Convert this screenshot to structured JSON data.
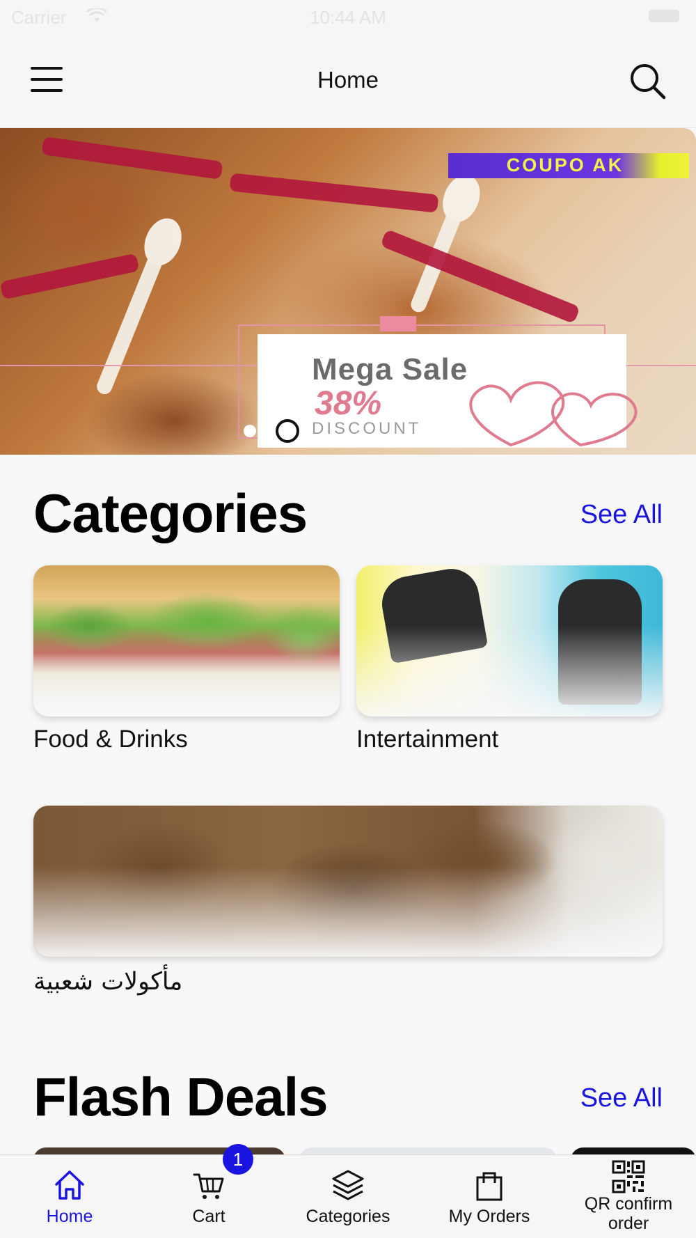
{
  "status_bar": {
    "carrier": "Carrier",
    "time": "10:44 AM"
  },
  "nav": {
    "title": "Home",
    "menu_icon": "hamburger-menu-icon",
    "search_icon": "search-icon"
  },
  "banner": {
    "logo_text": "COUPO AK",
    "headline": "Mega Sale",
    "discount_percent": "38%",
    "discount_label": "DISCOUNT",
    "slide_count": 2,
    "active_slide": 2
  },
  "categories": {
    "title": "Categories",
    "see_all": "See All",
    "items": [
      {
        "label": "Food & Drinks"
      },
      {
        "label": "Intertainment"
      },
      {
        "label": "مأكولات شعبية"
      }
    ]
  },
  "flash_deals": {
    "title": "Flash Deals",
    "see_all": "See All"
  },
  "tab_bar": {
    "items": [
      {
        "label": "Home",
        "icon": "home-icon",
        "active": true
      },
      {
        "label": "Cart",
        "icon": "cart-icon",
        "badge": "1"
      },
      {
        "label": "Categories",
        "icon": "layers-icon"
      },
      {
        "label": "My Orders",
        "icon": "shopping-bag-icon"
      },
      {
        "label": "QR confirm order",
        "icon": "qr-code-icon"
      }
    ]
  },
  "colors": {
    "accent": "#1a14e0",
    "background": "#f8f8f8",
    "text": "#111111"
  }
}
